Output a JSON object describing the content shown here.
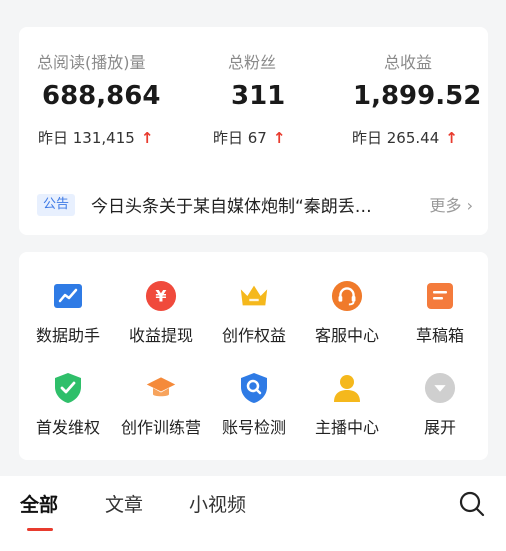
{
  "stats": [
    {
      "label": "总阅读(播放)量",
      "value": "688,864",
      "yesterday": "昨日 131,415",
      "trend": "↑"
    },
    {
      "label": "总粉丝",
      "value": "311",
      "yesterday": "昨日 67",
      "trend": "↑"
    },
    {
      "label": "总收益",
      "value": "1,899.52",
      "yesterday": "昨日 265.44",
      "trend": "↑"
    }
  ],
  "notice": {
    "badge": "公告",
    "text": "今日头条关于某自媒体炮制“秦朗丢…",
    "more": "更多 ›"
  },
  "tools": [
    {
      "label": "数据助手",
      "icon": "chart-icon",
      "color": "#2f7be5"
    },
    {
      "label": "收益提现",
      "icon": "yuan-icon",
      "color": "#f04a3c"
    },
    {
      "label": "创作权益",
      "icon": "crown-icon",
      "color": "#f5b81c"
    },
    {
      "label": "客服中心",
      "icon": "headset-icon",
      "color": "#f07a2a"
    },
    {
      "label": "草稿箱",
      "icon": "draft-icon",
      "color": "#f47b3c"
    },
    {
      "label": "首发维权",
      "icon": "shield-icon",
      "color": "#2fbf6a"
    },
    {
      "label": "创作训练营",
      "icon": "graduation-cap-icon",
      "color": "#f58a3a"
    },
    {
      "label": "账号检测",
      "icon": "search-check-icon",
      "color": "#2f7be5"
    },
    {
      "label": "主播中心",
      "icon": "person-icon",
      "color": "#f5b81c"
    },
    {
      "label": "展开",
      "icon": "expand-icon",
      "color": "#cfcfcf"
    }
  ],
  "tabs": [
    {
      "label": "全部",
      "active": true
    },
    {
      "label": "文章",
      "active": false
    },
    {
      "label": "小视频",
      "active": false
    }
  ]
}
